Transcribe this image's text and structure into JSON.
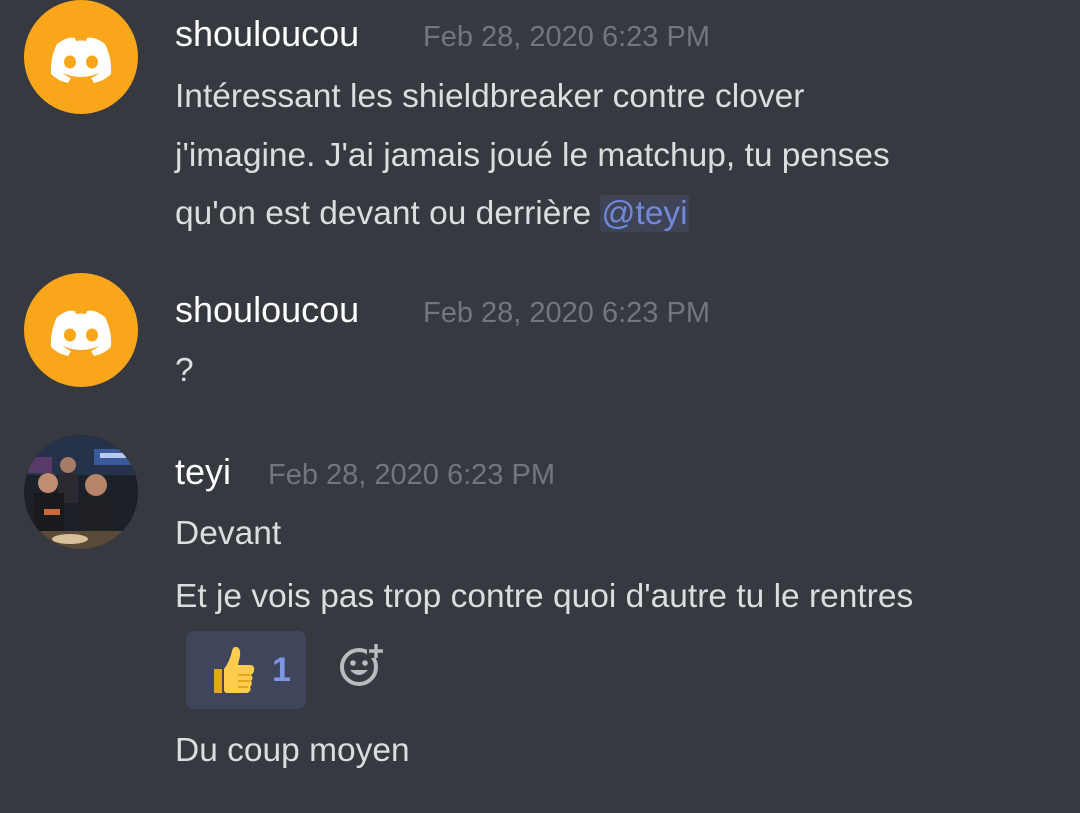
{
  "messages": [
    {
      "author": "shouloucou",
      "timestamp": "Feb 28, 2020 6:23 PM",
      "lines": [
        "Intéressant les shieldbreaker contre clover",
        "j'imagine. J'ai jamais joué le matchup, tu penses",
        "qu'on est devant ou derrière "
      ],
      "mention": "@teyi",
      "avatar_icon": "discord-logo-icon",
      "avatar_color": "#faa61a"
    },
    {
      "author": "shouloucou",
      "timestamp": "Feb 28, 2020 6:23 PM",
      "lines": [
        "?"
      ],
      "avatar_icon": "discord-logo-icon",
      "avatar_color": "#faa61a"
    },
    {
      "author": "teyi",
      "timestamp": "Feb 28, 2020 6:23 PM",
      "lines": [
        "Devant",
        "Et je vois pas trop contre quoi d'autre tu le rentres",
        "Du coup moyen"
      ],
      "avatar_icon": "user-photo-avatar",
      "reaction": {
        "emoji": "thumbs-up-icon",
        "count": "1"
      },
      "add_reaction_icon": "add-reaction-icon"
    }
  ],
  "colors": {
    "background": "#36393f",
    "username": "#ffffff",
    "timestamp": "#72767d",
    "text": "#dcddde",
    "mention": "#7289da",
    "reaction_bg": "#3f455b",
    "reaction_count": "#7f97e3"
  }
}
